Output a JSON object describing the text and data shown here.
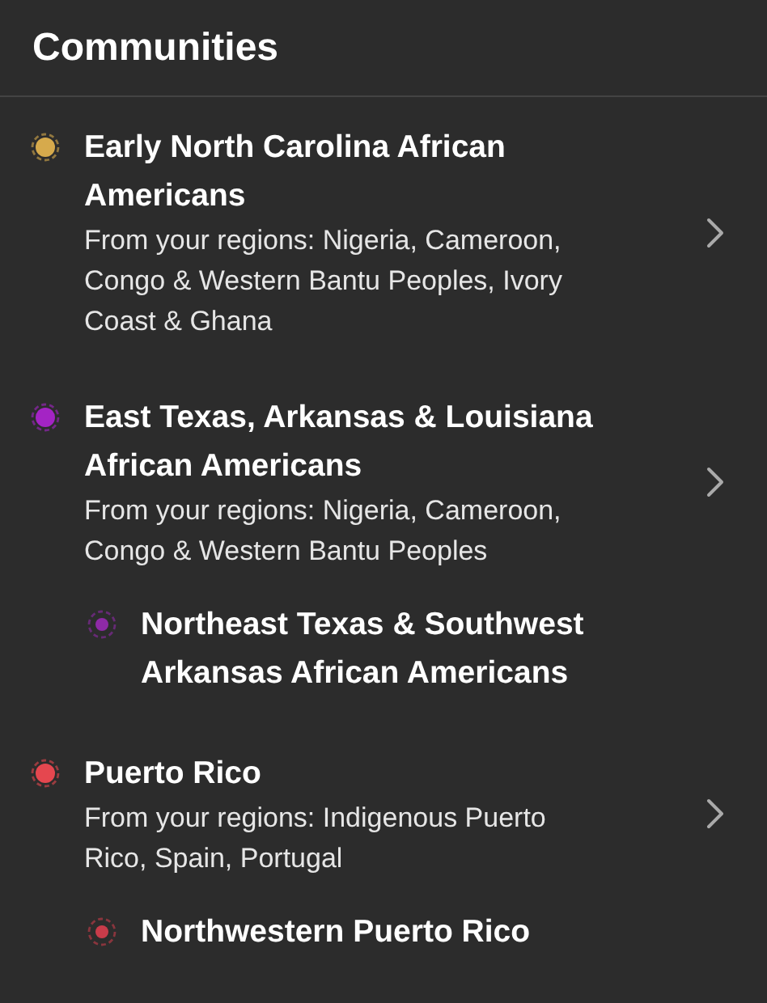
{
  "header": {
    "title": "Communities"
  },
  "communities": [
    {
      "title": "Early North Carolina African Americans",
      "subtitle": "From your regions: Nigeria, Cameroon, Congo & Western Bantu Peoples, Ivory Coast & Ghana",
      "color": "#d6aa4c"
    },
    {
      "title": "East Texas, Arkansas & Louisiana African Americans",
      "subtitle": "From your regions: Nigeria, Cameroon, Congo & Western Bantu Peoples",
      "color": "#a424c4",
      "children": [
        {
          "title": "Northeast Texas & Southwest Arkansas African Americans",
          "color": "#8e2aa6"
        }
      ]
    },
    {
      "title": "Puerto Rico",
      "subtitle": "From your regions: Indigenous Puerto Rico, Spain, Portugal",
      "color": "#e5474f",
      "children": [
        {
          "title": "Northwestern Puerto Rico",
          "color": "#c83c4a"
        }
      ]
    }
  ]
}
